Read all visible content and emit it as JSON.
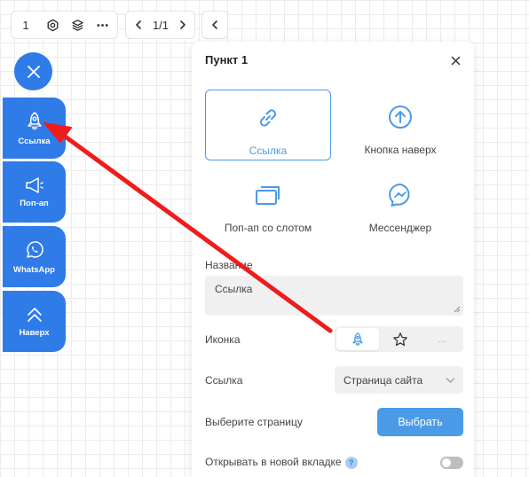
{
  "toolbar": {
    "index": "1",
    "page_indicator": "1/1"
  },
  "sidebar": {
    "buttons": [
      {
        "label": "Ссылка",
        "icon": "rocket-icon"
      },
      {
        "label": "Поп-ап",
        "icon": "megaphone-icon"
      },
      {
        "label": "WhatsApp",
        "icon": "whatsapp-icon"
      },
      {
        "label": "Наверх",
        "icon": "double-chevron-up-icon"
      }
    ]
  },
  "panel": {
    "title": "Пункт 1",
    "types": [
      {
        "label": "Ссылка",
        "icon": "link-icon",
        "selected": true
      },
      {
        "label": "Кнопка наверх",
        "icon": "arrow-up-circle-icon",
        "selected": false
      },
      {
        "label": "Поп-ап со слотом",
        "icon": "windows-icon",
        "selected": false
      },
      {
        "label": "Мессенджер",
        "icon": "messenger-icon",
        "selected": false
      }
    ],
    "name_label": "Название",
    "name_value": "Ссылка",
    "icon_label": "Иконка",
    "icon_more": "...",
    "link_label": "Ссылка",
    "link_select": "Страница сайта",
    "page_label": "Выберите страницу",
    "page_button": "Выбрать",
    "newtab_label": "Открывать в новой вкладке",
    "help_mark": "?",
    "newtab_enabled": false
  },
  "colors": {
    "primary": "#2f7be8",
    "accent": "#4a9ae8",
    "arrow": "#ee1c1c"
  }
}
